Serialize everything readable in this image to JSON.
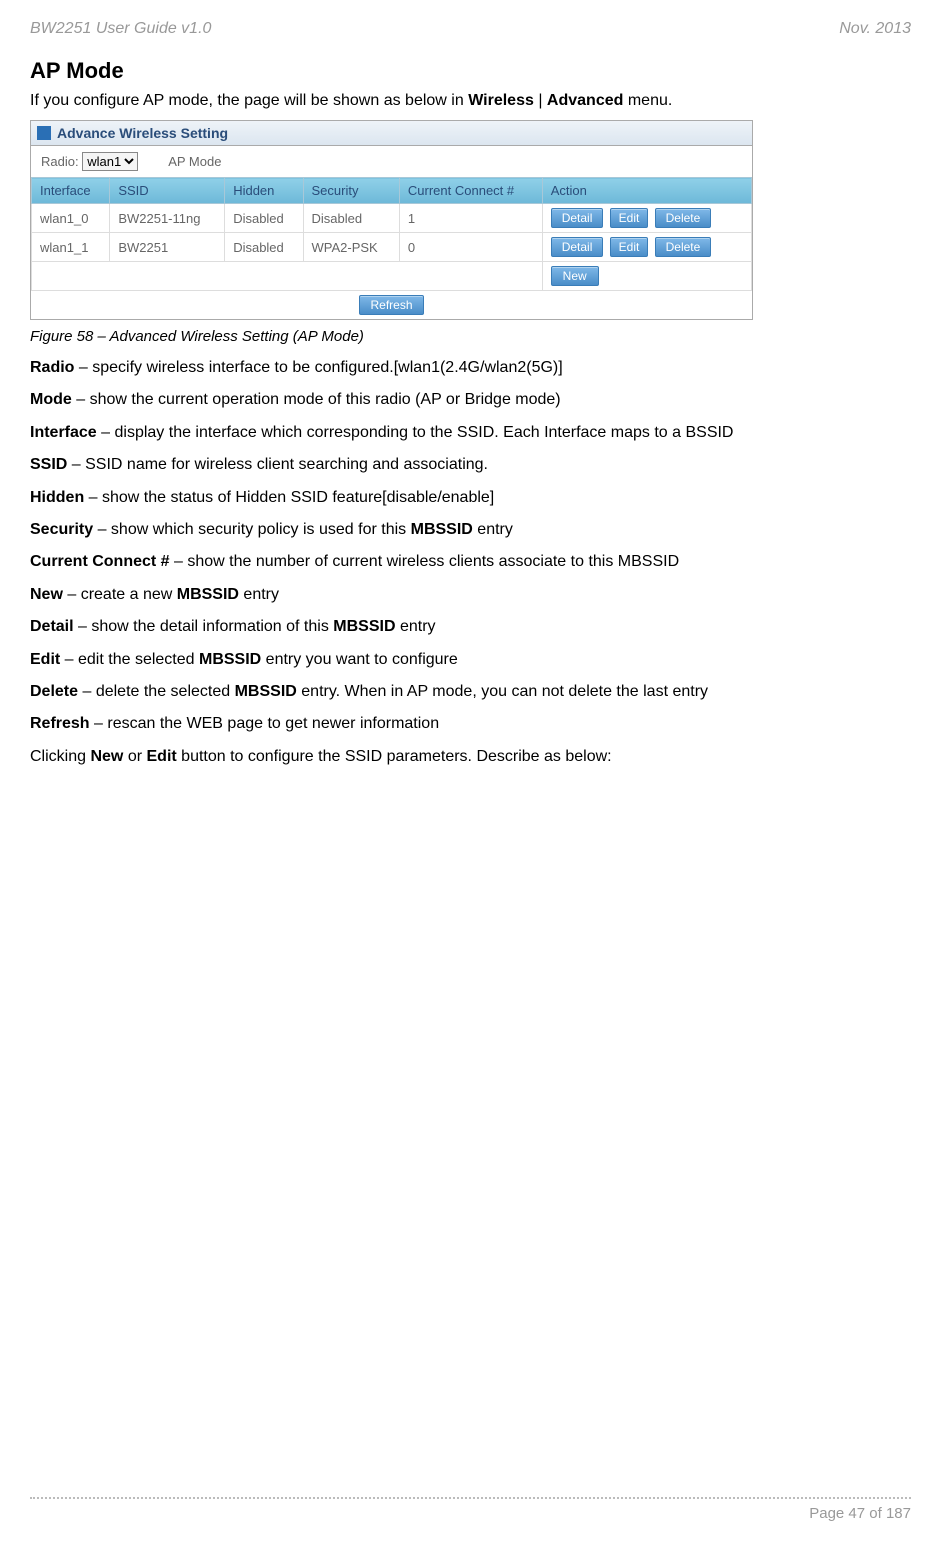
{
  "header": {
    "left": "BW2251 User Guide v1.0",
    "right": "Nov.  2013"
  },
  "section_title": "AP Mode",
  "intro": {
    "prefix": "If you configure AP mode, the page will be shown as below in ",
    "bold1": "Wireless",
    "sep": " | ",
    "bold2": "Advanced",
    "suffix": " menu."
  },
  "app": {
    "title": "Advance Wireless Setting",
    "radio_label": "Radio:",
    "radio_options": [
      "wlan1"
    ],
    "radio_selected": "wlan1",
    "mode_label": "AP Mode",
    "columns": [
      "Interface",
      "SSID",
      "Hidden",
      "Security",
      "Current Connect #",
      "Action"
    ],
    "rows": [
      {
        "interface": "wlan1_0",
        "ssid": "BW2251-11ng",
        "hidden": "Disabled",
        "security": "Disabled",
        "connect": "1"
      },
      {
        "interface": "wlan1_1",
        "ssid": "BW2251",
        "hidden": "Disabled",
        "security": "WPA2-PSK",
        "connect": "0"
      }
    ],
    "buttons": {
      "detail": "Detail",
      "edit": "Edit",
      "delete": "Delete",
      "new": "New",
      "refresh": "Refresh"
    }
  },
  "figure_caption": "Figure 58 – Advanced Wireless Setting (AP Mode)",
  "definitions": [
    {
      "term": "Radio",
      "desc": " – specify wireless interface to be configured.[wlan1(2.4G/wlan2(5G)]"
    },
    {
      "term": "Mode",
      "desc": " – show the current operation mode of this radio (AP or Bridge mode)"
    },
    {
      "term": "Interface",
      "desc": " – display the interface which corresponding to the SSID. Each Interface maps to a BSSID"
    },
    {
      "term": "SSID",
      "desc": " – SSID name for wireless client searching and associating."
    },
    {
      "term": "Hidden",
      "desc": " – show the status of Hidden SSID feature[disable/enable]"
    },
    {
      "term": "Security",
      "desc_prefix": " – show which security policy is used for this ",
      "bold": "MBSSID",
      "desc_suffix": " entry"
    },
    {
      "term": "Current Connect #",
      "desc": " – show the number of current wireless clients associate to  this MBSSID"
    },
    {
      "term": "New",
      "desc_prefix": " – create a new ",
      "bold": "MBSSID",
      "desc_suffix": " entry"
    },
    {
      "term": "Detail",
      "desc_prefix": " – show the detail information of this ",
      "bold": "MBSSID",
      "desc_suffix": " entry"
    },
    {
      "term": "Edit",
      "desc_prefix": " – edit the selected ",
      "bold": "MBSSID",
      "desc_suffix": " entry you want to configure"
    },
    {
      "term": "Delete",
      "desc_prefix": " – delete the selected ",
      "bold": "MBSSID",
      "desc_suffix": " entry. When in AP mode, you can not delete the last entry"
    },
    {
      "term": "Refresh",
      "desc": " – rescan the WEB page to get newer information"
    }
  ],
  "closing_line": {
    "prefix": "Clicking ",
    "bold1": "New",
    "mid": " or ",
    "bold2": "Edit",
    "suffix": " button to configure the SSID parameters. Describe as below:"
  },
  "footer": {
    "page": "Page 47 of 187"
  }
}
